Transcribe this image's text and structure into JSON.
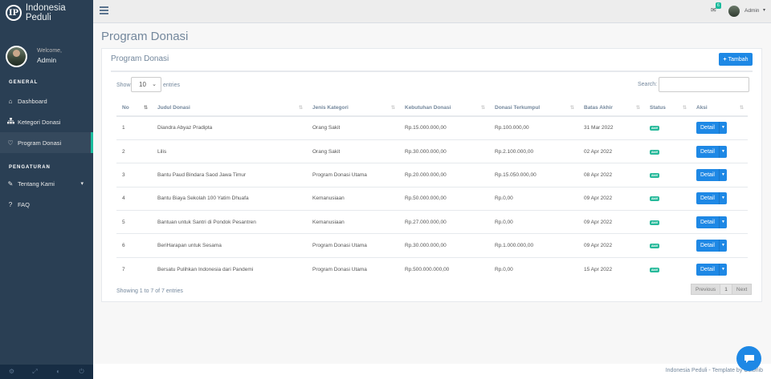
{
  "brand": {
    "logo_letters": "IP",
    "name": "Indonesia Peduli"
  },
  "profile": {
    "welcome": "Welcome,",
    "name": "Admin"
  },
  "sidebar": {
    "section_general": "GENERAL",
    "items": [
      {
        "label": "Dashboard",
        "icon": "home-icon"
      },
      {
        "label": "Ketegori Donasi",
        "icon": "sitemap-icon"
      },
      {
        "label": "Program Donasi",
        "icon": "hand-heart-icon"
      }
    ],
    "section_settings": "PENGATURAN",
    "settings_items": [
      {
        "label": "Tentang Kami",
        "icon": "edit-icon"
      },
      {
        "label": "FAQ",
        "icon": "question-icon"
      }
    ]
  },
  "topnav": {
    "mail_count": "6",
    "user": "Admin"
  },
  "page": {
    "title": "Program Donasi"
  },
  "panel": {
    "title": "Program Donasi",
    "add_button": "Tambah",
    "show_label": "Show",
    "show_value": "10",
    "entries_label": "entries",
    "search_label": "Search:",
    "columns": [
      "No",
      "Judul Donasi",
      "Jenis Kategori",
      "Kebutuhan Donasi",
      "Donasi Terkumpul",
      "Batas Akhir",
      "Status",
      "Aksi"
    ],
    "rows": [
      {
        "no": "1",
        "judul": "Diandra Abyaz Pradipta",
        "kategori": "Orang Sakit",
        "kebutuhan": "Rp.15.000.000,00",
        "terkumpul": "Rp.100.000,00",
        "batas": "31 Mar 2022",
        "status": "Aktif",
        "aksi": "Detail"
      },
      {
        "no": "2",
        "judul": "Lilis",
        "kategori": "Orang Sakit",
        "kebutuhan": "Rp.30.000.000,00",
        "terkumpul": "Rp.2.100.000,00",
        "batas": "02 Apr 2022",
        "status": "Aktif",
        "aksi": "Detail"
      },
      {
        "no": "3",
        "judul": "Bantu Paud Bindara Saod Jawa Timur",
        "kategori": "Program Donasi Utama",
        "kebutuhan": "Rp.20.000.000,00",
        "terkumpul": "Rp.15.050.000,00",
        "batas": "08 Apr 2022",
        "status": "Aktif",
        "aksi": "Detail"
      },
      {
        "no": "4",
        "judul": "Bantu Biaya Sekolah 100 Yatim Dhuafa",
        "kategori": "Kemanusiaan",
        "kebutuhan": "Rp.50.000.000,00",
        "terkumpul": "Rp.0,00",
        "batas": "09 Apr 2022",
        "status": "Aktif",
        "aksi": "Detail"
      },
      {
        "no": "5",
        "judul": "Bantuan untuk Santri di Pondok Pesantren",
        "kategori": "Kemanusiaan",
        "kebutuhan": "Rp.27.000.000,00",
        "terkumpul": "Rp.0,00",
        "batas": "09 Apr 2022",
        "status": "Aktif",
        "aksi": "Detail"
      },
      {
        "no": "6",
        "judul": "BeriHarapan untuk Sesama",
        "kategori": "Program Donasi Utama",
        "kebutuhan": "Rp.30.000.000,00",
        "terkumpul": "Rp.1.000.000,00",
        "batas": "09 Apr 2022",
        "status": "Aktif",
        "aksi": "Detail"
      },
      {
        "no": "7",
        "judul": "Bersatu Pulihkan Indonesia dari Pandemi",
        "kategori": "Program Donasi Utama",
        "kebutuhan": "Rp.500.000.000,00",
        "terkumpul": "Rp.0,00",
        "batas": "15 Apr 2022",
        "status": "Aktif",
        "aksi": "Detail"
      }
    ],
    "info": "Showing 1 to 7 of 7 entries",
    "pager": {
      "prev": "Previous",
      "page": "1",
      "next": "Next"
    }
  },
  "footer": {
    "text": "Indonesia Peduli - Template by Colorlib"
  },
  "colors": {
    "sidebar": "#2A3F54",
    "accent": "#1ABB9C",
    "primary": "#1E88E5",
    "status": "#26B99A"
  }
}
